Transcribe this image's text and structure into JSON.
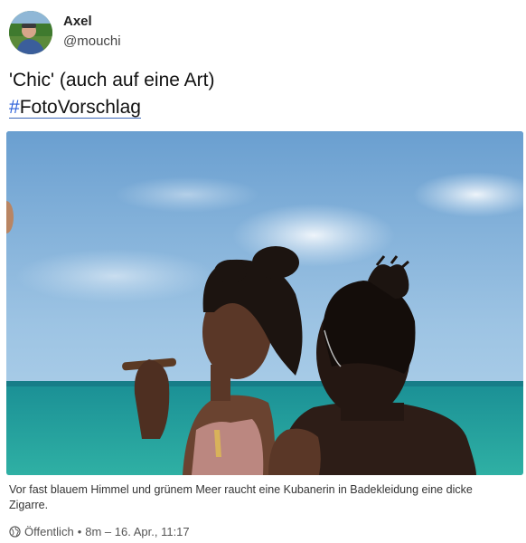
{
  "author": {
    "name": "Axel",
    "handle": "@mouchi",
    "avatar_icon": "user-avatar-photo"
  },
  "post": {
    "text": "'Chic' (auch auf eine Art)",
    "hashtag_symbol": "#",
    "hashtag_text": "FotoVorschlag",
    "image_icon": "beach-photo",
    "image_caption": "Vor fast blauem Himmel und grünem Meer raucht eine Kubanerin in Badekleidung eine dicke Zigarre."
  },
  "meta": {
    "visibility_icon": "globe-icon",
    "visibility": "Öffentlich",
    "separator": "•",
    "time": "8m – 16. Apr., 11:17"
  },
  "colors": {
    "hashtag_accent": "#2b5fd9",
    "sky": "#6fa3cf",
    "sea": "#1e9e98"
  }
}
